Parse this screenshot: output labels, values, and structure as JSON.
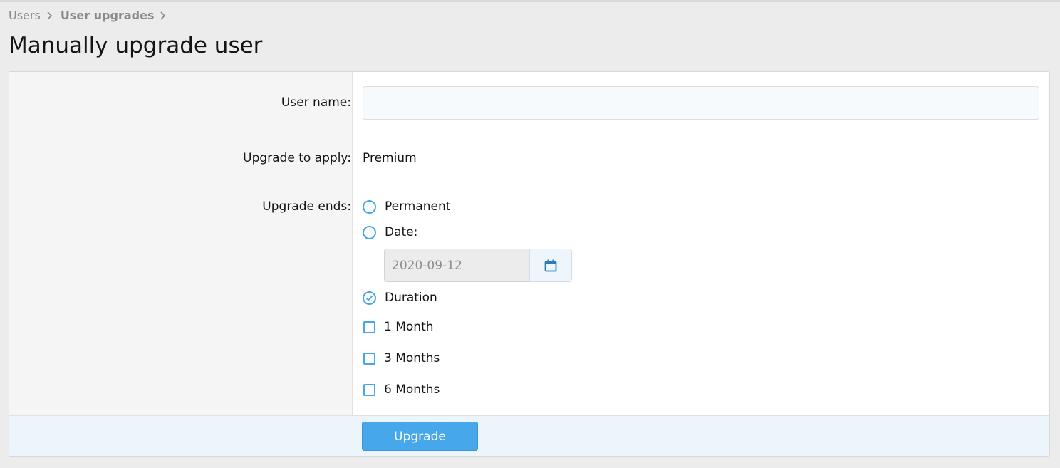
{
  "breadcrumb": {
    "items": [
      {
        "label": "Users"
      },
      {
        "label": "User upgrades"
      }
    ]
  },
  "page": {
    "title": "Manually upgrade user"
  },
  "form": {
    "user_name": {
      "label": "User name:",
      "value": ""
    },
    "upgrade": {
      "label": "Upgrade to apply:",
      "value": "Premium"
    },
    "ends": {
      "label": "Upgrade ends:",
      "permanent": "Permanent",
      "date": "Date:",
      "date_value": "2020-09-12",
      "duration": "Duration",
      "selected": "duration",
      "durations": [
        "1 Month",
        "3 Months",
        "6 Months"
      ]
    }
  },
  "submit": {
    "label": "Upgrade"
  },
  "colors": {
    "accent": "#47a7eb",
    "footer_bg": "#edf5fc"
  },
  "icons": {
    "separator": "chevron-right-icon",
    "date_picker": "calendar-icon",
    "selected_radio": "checkmark-icon"
  }
}
